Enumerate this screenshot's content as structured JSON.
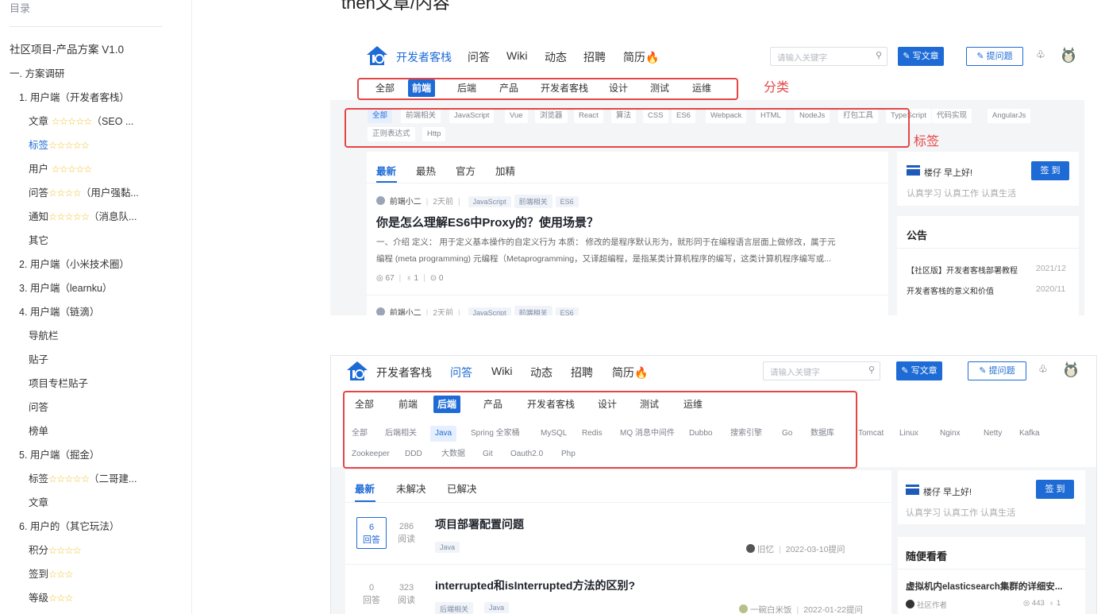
{
  "sidebar": {
    "title": "目录",
    "items": [
      {
        "level": 0,
        "text": "社区项目-产品方案 V1.0"
      },
      {
        "level": 1,
        "text": "一. 方案调研"
      },
      {
        "level": 2,
        "text": "1. 用户端（开发者客栈）"
      },
      {
        "level": 3,
        "text": "文章 ☆☆☆☆☆（SEO ..."
      },
      {
        "level": 3,
        "text": "标签☆☆☆☆☆",
        "active": true
      },
      {
        "level": 3,
        "text": "用户 ☆☆☆☆☆"
      },
      {
        "level": 3,
        "text": "问答☆☆☆☆（用户强黏..."
      },
      {
        "level": 3,
        "text": "通知☆☆☆☆☆（消息队..."
      },
      {
        "level": 3,
        "text": "其它"
      },
      {
        "level": 2,
        "text": "2. 用户端（小米技术圈）"
      },
      {
        "level": 2,
        "text": "3. 用户端（learnku）"
      },
      {
        "level": 2,
        "text": "4. 用户端（链滴）"
      },
      {
        "level": 3,
        "text": "导航栏"
      },
      {
        "level": 3,
        "text": "贴子"
      },
      {
        "level": 3,
        "text": "项目专栏贴子"
      },
      {
        "level": 3,
        "text": "问答"
      },
      {
        "level": 3,
        "text": "榜单"
      },
      {
        "level": 2,
        "text": "5. 用户端（掘金）"
      },
      {
        "level": 3,
        "text": "标签☆☆☆☆☆（二哥建..."
      },
      {
        "level": 3,
        "text": "文章"
      },
      {
        "level": 2,
        "text": "6. 用户的（其它玩法）"
      },
      {
        "level": 3,
        "text": "积分☆☆☆☆"
      },
      {
        "level": 3,
        "text": "签到☆☆☆"
      },
      {
        "level": 3,
        "text": "等级☆☆☆"
      }
    ]
  },
  "doc_heading": "then文章/内容",
  "shot1": {
    "brand": "开发者客栈",
    "nav": [
      "问答",
      "Wiki",
      "动态",
      "招聘",
      "简历"
    ],
    "fire": "🔥",
    "search_placeholder": "请输入关键字",
    "write_btn": "✎ 写文章",
    "ask_btn": "✎ 提问题",
    "categories": [
      "全部",
      "前端",
      "后端",
      "产品",
      "开发者客栈",
      "设计",
      "测试",
      "运维"
    ],
    "active_category": 1,
    "category_label": "分类",
    "tags_row1": [
      "全部",
      "前端相关",
      "JavaScript",
      "Vue",
      "浏览器",
      "React",
      "算法",
      "CSS",
      "ES6",
      "Webpack",
      "HTML",
      "NodeJs",
      "打包工具",
      "TypeScript",
      "代码实现",
      "AngularJs"
    ],
    "tags_row2": [
      "正则表达式",
      "Http"
    ],
    "tag_label": "标签",
    "tabs": [
      "最新",
      "最热",
      "官方",
      "加精"
    ],
    "post": {
      "author": "前端小二",
      "time": "2天前",
      "tags": [
        "JavaScript",
        "前端相关",
        "ES6"
      ],
      "title": "你是怎么理解ES6中Proxy的？使用场景？",
      "excerpt_1": "一、介绍 定义： 用于定义基本操作的自定义行为 本质： 修改的是程序默认形为，就形同于在编程语言层面上做修改，属于元",
      "excerpt_2": "编程 (meta programming) 元编程（Metaprogramming，又译超编程，是指某类计算机程序的编写，这类计算机程序编写或...",
      "views": "◎ 67",
      "likes": "♁ 1",
      "comments": "⊙ 0"
    },
    "post2": {
      "author": "前端小二",
      "time": "2天前",
      "tags": [
        "JavaScript",
        "前端相关",
        "ES6"
      ]
    },
    "user_card": {
      "greet": "楼仔 早上好!",
      "sub": "认真学习 认真工作 认真生活",
      "checkin": "签 到"
    },
    "notice": {
      "title": "公告",
      "items": [
        {
          "text": "【社区版】开发者客栈部署教程",
          "date": "2021/12"
        },
        {
          "text": "开发者客栈的意义和价值",
          "date": "2020/11"
        }
      ]
    }
  },
  "shot2": {
    "brand": "开发者客栈",
    "nav": [
      "问答",
      "Wiki",
      "动态",
      "招聘",
      "简历"
    ],
    "fire": "🔥",
    "search_placeholder": "请输入关键字",
    "write_btn": "✎ 写文章",
    "ask_btn": "✎ 提问题",
    "categories": [
      "全部",
      "前端",
      "后端",
      "产品",
      "开发者客栈",
      "设计",
      "测试",
      "运维"
    ],
    "active_category": 2,
    "tags_row1": [
      "全部",
      "后端相关",
      "Java",
      "Spring 全家桶",
      "MySQL",
      "Redis",
      "MQ 消息中间件",
      "Dubbo",
      "搜索引擎",
      "Go",
      "数据库",
      "Tomcat",
      "Linux",
      "Nginx",
      "Netty",
      "Kafka"
    ],
    "tags_row2": [
      "Zookeeper",
      "DDD",
      "大数据",
      "Git",
      "Oauth2.0",
      "Php"
    ],
    "tabs": [
      "最新",
      "未解决",
      "已解决"
    ],
    "questions": [
      {
        "answers": "6",
        "answers_label": "回答",
        "reads": "286",
        "reads_label": "阅读",
        "title": "项目部署配置问题",
        "tags": [
          "Java"
        ],
        "author": "旧忆",
        "date": "2022-03-10提问"
      },
      {
        "answers": "0",
        "answers_label": "回答",
        "reads": "323",
        "reads_label": "阅读",
        "title": "interrupted和isInterrupted方法的区别?",
        "tags": [
          "后端相关",
          "Java"
        ],
        "author": "一碗白米饭",
        "date": "2022-01-22提问"
      }
    ],
    "user_card": {
      "greet": "楼仔 早上好!",
      "sub": "认真学习 认真工作 认真生活",
      "checkin": "签 到"
    },
    "random": {
      "title": "随便看看",
      "item_title": "虚拟机内elasticsearch集群的详细安...",
      "item_author": "社区作者",
      "item_views": "◎ 443",
      "item_likes": "♁ 1"
    }
  },
  "colors": {
    "accent": "#1e6bd6",
    "annotation": "#e64545",
    "star": "#f2c230"
  }
}
